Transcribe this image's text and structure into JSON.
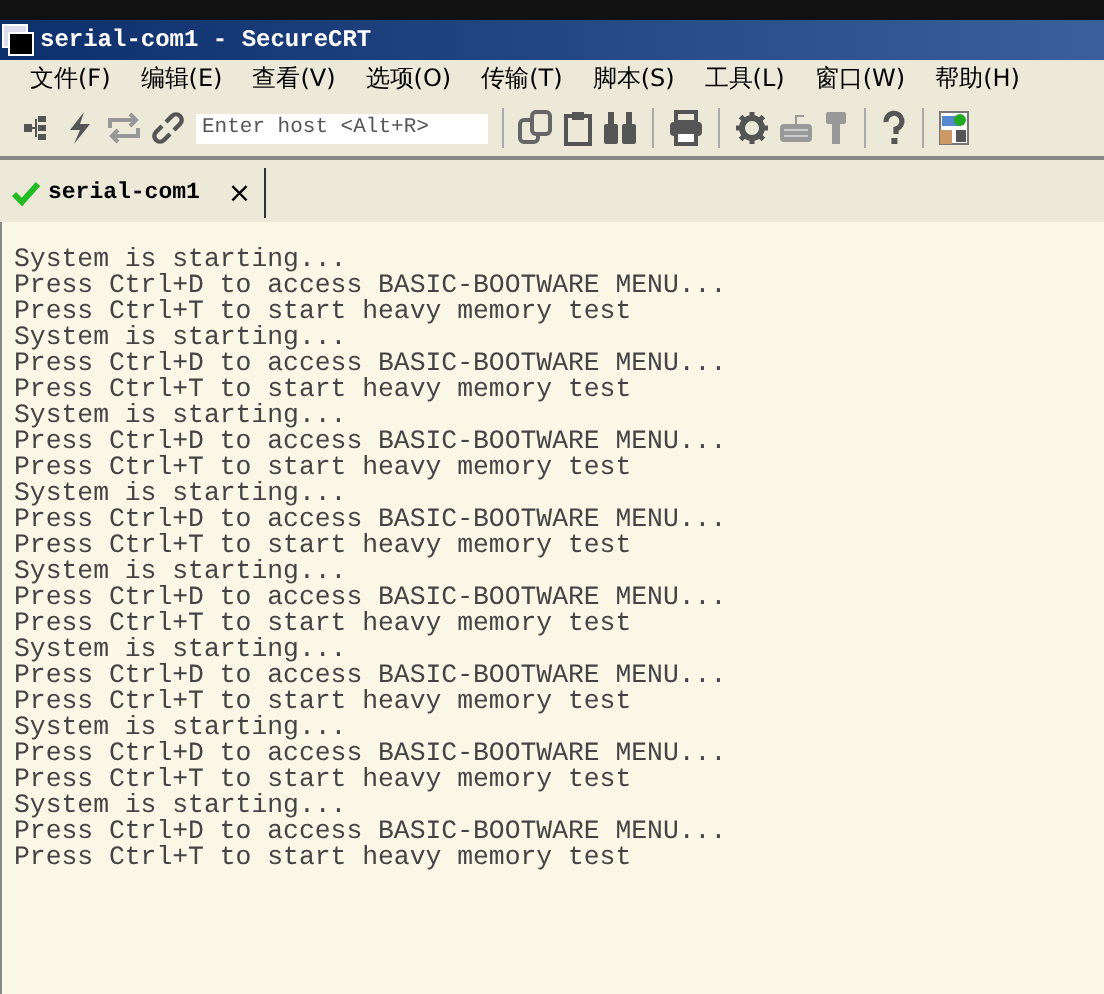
{
  "window": {
    "title": "serial-com1 - SecureCRT"
  },
  "menu": [
    "文件(F)",
    "编辑(E)",
    "查看(V)",
    "选项(O)",
    "传输(T)",
    "脚本(S)",
    "工具(L)",
    "窗口(W)",
    "帮助(H)"
  ],
  "host_field": {
    "placeholder": "Enter host <Alt+R>"
  },
  "tabs": [
    {
      "label": "serial-com1",
      "close": "×",
      "selected": true,
      "connected": true
    }
  ],
  "terminal": {
    "lines": [
      "System is starting...",
      "Press Ctrl+D to access BASIC-BOOTWARE MENU...",
      "Press Ctrl+T to start heavy memory test",
      "System is starting...",
      "Press Ctrl+D to access BASIC-BOOTWARE MENU...",
      "Press Ctrl+T to start heavy memory test",
      "System is starting...",
      "Press Ctrl+D to access BASIC-BOOTWARE MENU...",
      "Press Ctrl+T to start heavy memory test",
      "System is starting...",
      "Press Ctrl+D to access BASIC-BOOTWARE MENU...",
      "Press Ctrl+T to start heavy memory test",
      "System is starting...",
      "Press Ctrl+D to access BASIC-BOOTWARE MENU...",
      "Press Ctrl+T to start heavy memory test",
      "System is starting...",
      "Press Ctrl+D to access BASIC-BOOTWARE MENU...",
      "Press Ctrl+T to start heavy memory test",
      "System is starting...",
      "Press Ctrl+D to access BASIC-BOOTWARE MENU...",
      "Press Ctrl+T to start heavy memory test",
      "System is starting...",
      "Press Ctrl+D to access BASIC-BOOTWARE MENU...",
      "Press Ctrl+T to start heavy memory test"
    ]
  }
}
